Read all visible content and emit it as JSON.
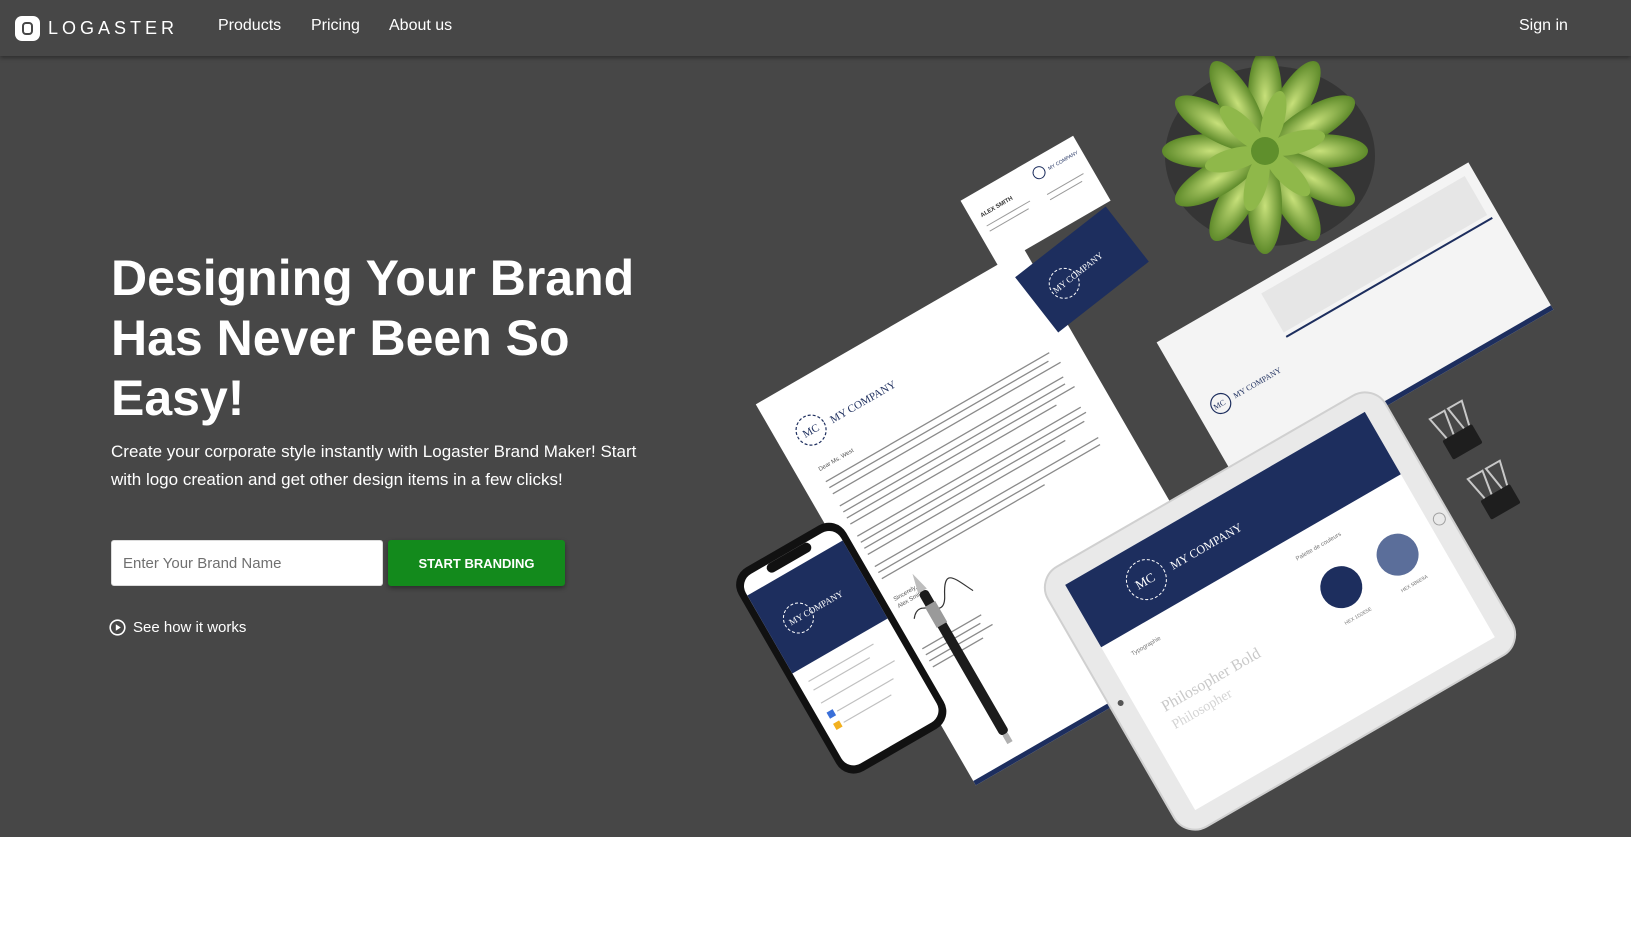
{
  "nav": {
    "brand": "LOGASTER",
    "links": [
      "Products",
      "Pricing",
      "About us"
    ],
    "signin": "Sign in"
  },
  "hero": {
    "title": "Designing Your Brand Has Never Been So Easy!",
    "subtitle": "Create your corporate style instantly with Logaster Brand Maker! Start with logo creation and get other design items in a few clicks!",
    "input_placeholder": "Enter Your Brand Name",
    "cta": "START BRANDING",
    "how_link": "See how it works"
  },
  "mockup": {
    "company": "MY COMPANY",
    "monogram": "MC",
    "card_name": "ALEX SMITH",
    "greeting": "Dear Ms. West",
    "sign_off": "Sincerely,",
    "signer": "Alex Smith",
    "font_bold": "Philosopher Bold",
    "font_regular": "Philosopher",
    "typography_label": "Typographie",
    "palette_label": "Palette de couleurs",
    "hex_1": "HEX 1D2E5E",
    "hex_2": "HEX 5B6E9A"
  },
  "colors": {
    "header_bg": "#474747",
    "hero_bg": "#474747",
    "cta_bg": "#138a1c",
    "navy": "#1d2e5e",
    "slate": "#5b6e9a"
  }
}
